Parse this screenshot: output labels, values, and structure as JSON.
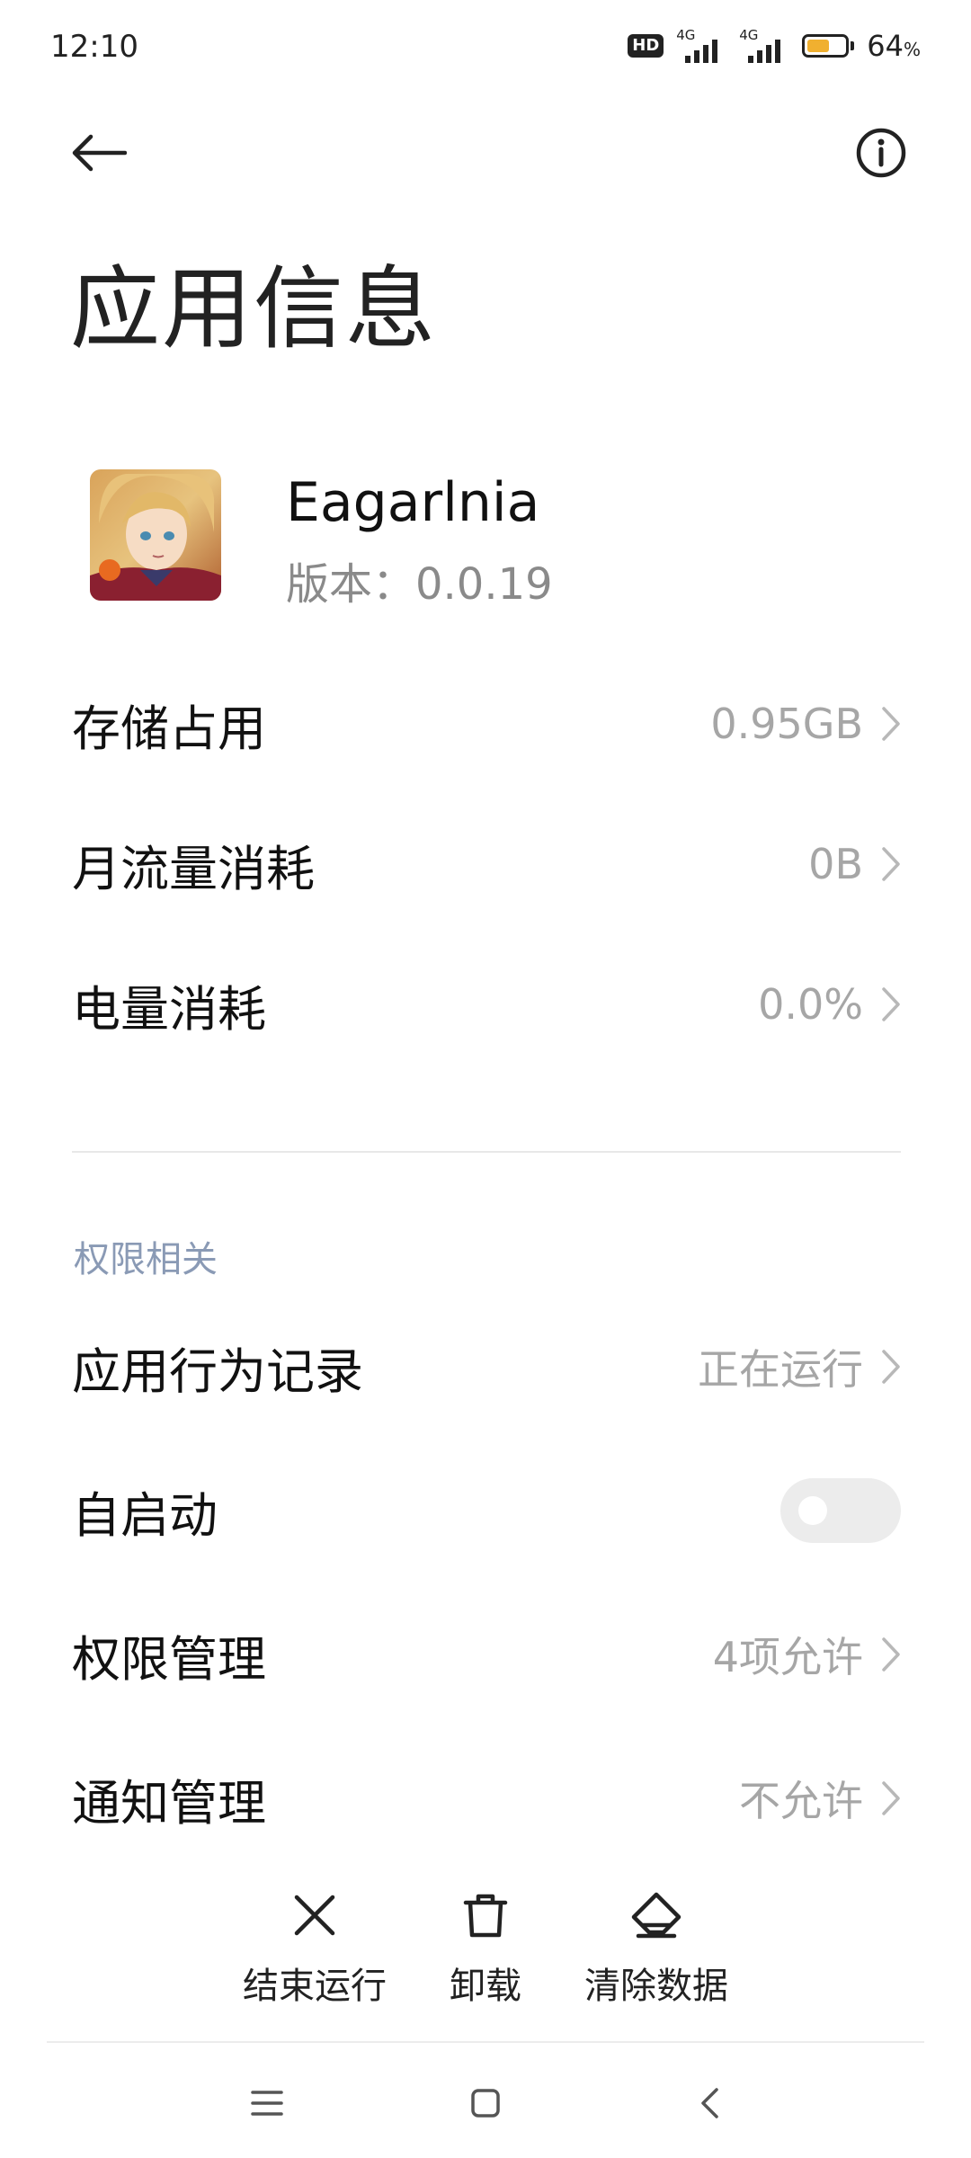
{
  "status_bar": {
    "time": "12:10",
    "hd_label": "HD",
    "network_1": "4G",
    "network_2": "4G",
    "battery_percent": "64",
    "battery_unit": "%",
    "battery_level": 0.64
  },
  "header": {
    "back_icon": "arrow-left-icon",
    "info_icon": "info-circle-icon",
    "title": "应用信息"
  },
  "app": {
    "name": "Eagarlnia",
    "version": "版本：0.0.19"
  },
  "usage_rows": [
    {
      "label": "存储占用",
      "value": "0.95GB"
    },
    {
      "label": "月流量消耗",
      "value": "0B"
    },
    {
      "label": "电量消耗",
      "value": "0.0%"
    }
  ],
  "permissions": {
    "section_title": "权限相关",
    "rows": [
      {
        "label": "应用行为记录",
        "value": "正在运行"
      },
      {
        "label": "自启动",
        "toggle_on": false
      },
      {
        "label": "权限管理",
        "value": "4项允许"
      },
      {
        "label": "通知管理",
        "value": "不允许"
      }
    ]
  },
  "actions": [
    {
      "label": "结束运行",
      "icon": "close-x-icon"
    },
    {
      "label": "卸载",
      "icon": "trash-icon"
    },
    {
      "label": "清除数据",
      "icon": "eraser-icon"
    }
  ],
  "nav_bar": {
    "menu_icon": "menu-icon",
    "home_icon": "home-square-icon",
    "back_icon": "back-chevron-icon"
  },
  "colors": {
    "toggle_off_track": "#ececec",
    "section_header": "#8a9ab5",
    "secondary_text": "#a6a6a6",
    "battery_fill": "#f0b030"
  }
}
